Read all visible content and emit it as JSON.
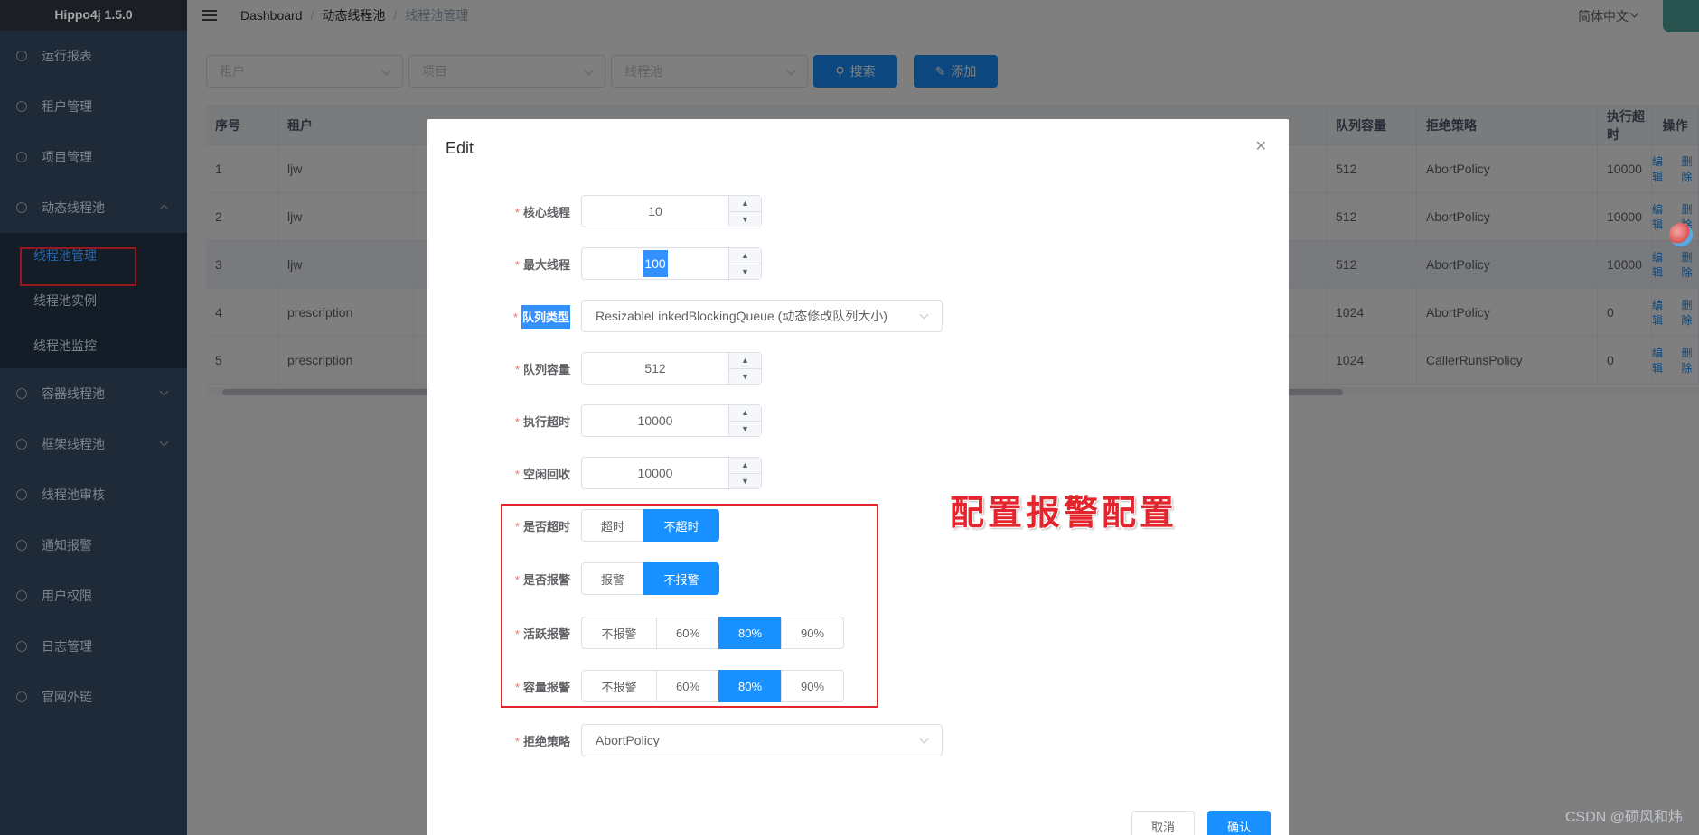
{
  "app": {
    "title": "Hippo4j 1.5.0"
  },
  "sidebar": {
    "items": [
      {
        "label": "运行报表"
      },
      {
        "label": "租户管理"
      },
      {
        "label": "项目管理"
      },
      {
        "label": "动态线程池",
        "expanded": true
      }
    ],
    "sub_items": [
      {
        "label": "线程池管理",
        "active": true
      },
      {
        "label": "线程池实例"
      },
      {
        "label": "线程池监控"
      }
    ],
    "items_after": [
      {
        "label": "容器线程池"
      },
      {
        "label": "框架线程池"
      },
      {
        "label": "线程池审核"
      },
      {
        "label": "通知报警"
      },
      {
        "label": "用户权限"
      },
      {
        "label": "日志管理"
      },
      {
        "label": "官网外链"
      }
    ]
  },
  "navbar": {
    "breadcrumb": [
      "Dashboard",
      "动态线程池",
      "线程池管理"
    ],
    "language": "简体中文"
  },
  "filters": {
    "tenant_placeholder": "租户",
    "project_placeholder": "项目",
    "pool_placeholder": "线程池",
    "search_label": "搜索",
    "add_label": "添加"
  },
  "table": {
    "headers": [
      "序号",
      "租户",
      "队列容量",
      "拒绝策略",
      "执行超时",
      "操作"
    ],
    "rows": [
      {
        "no": "1",
        "tenant": "ljw",
        "capacity": "512",
        "policy": "AbortPolicy",
        "timeout": "10000"
      },
      {
        "no": "2",
        "tenant": "ljw",
        "capacity": "512",
        "policy": "AbortPolicy",
        "timeout": "10000"
      },
      {
        "no": "3",
        "tenant": "ljw",
        "capacity": "512",
        "policy": "AbortPolicy",
        "timeout": "10000"
      },
      {
        "no": "4",
        "tenant": "prescription",
        "capacity": "1024",
        "policy": "AbortPolicy",
        "timeout": "0"
      },
      {
        "no": "5",
        "tenant": "prescription",
        "capacity": "1024",
        "policy": "CallerRunsPolicy",
        "timeout": "0"
      }
    ],
    "op_edit": "编辑",
    "op_delete": "删除"
  },
  "dialog": {
    "title": "Edit",
    "fields": {
      "core_label": "核心线程",
      "core_value": "10",
      "max_label": "最大线程",
      "max_value": "100",
      "queue_type_label": "队列类型",
      "queue_type_value": "ResizableLinkedBlockingQueue (动态修改队列大小)",
      "queue_cap_label": "队列容量",
      "queue_cap_value": "512",
      "exec_timeout_label": "执行超时",
      "exec_timeout_value": "10000",
      "keepalive_label": "空闲回收",
      "keepalive_value": "10000",
      "is_timeout_label": "是否超时",
      "is_timeout_options": [
        "超时",
        "不超时"
      ],
      "is_alarm_label": "是否报警",
      "is_alarm_options": [
        "报警",
        "不报警"
      ],
      "active_alarm_label": "活跃报警",
      "active_alarm_options": [
        "不报警",
        "60%",
        "80%",
        "90%"
      ],
      "capacity_alarm_label": "容量报警",
      "capacity_alarm_options": [
        "不报警",
        "60%",
        "80%",
        "90%"
      ],
      "reject_label": "拒绝策略",
      "reject_value": "AbortPolicy"
    },
    "selected": {
      "is_timeout": "不超时",
      "is_alarm": "不报警",
      "active_alarm": "80%",
      "capacity_alarm": "80%"
    },
    "cancel_label": "取消",
    "confirm_label": "确认"
  },
  "annotation": {
    "text": "配置报警配置"
  },
  "watermark": {
    "text": "CSDN @硕风和炜"
  },
  "colors": {
    "primary": "#1890ff",
    "sidebar_bg": "#304156",
    "annotation_red": "#e3262d"
  }
}
